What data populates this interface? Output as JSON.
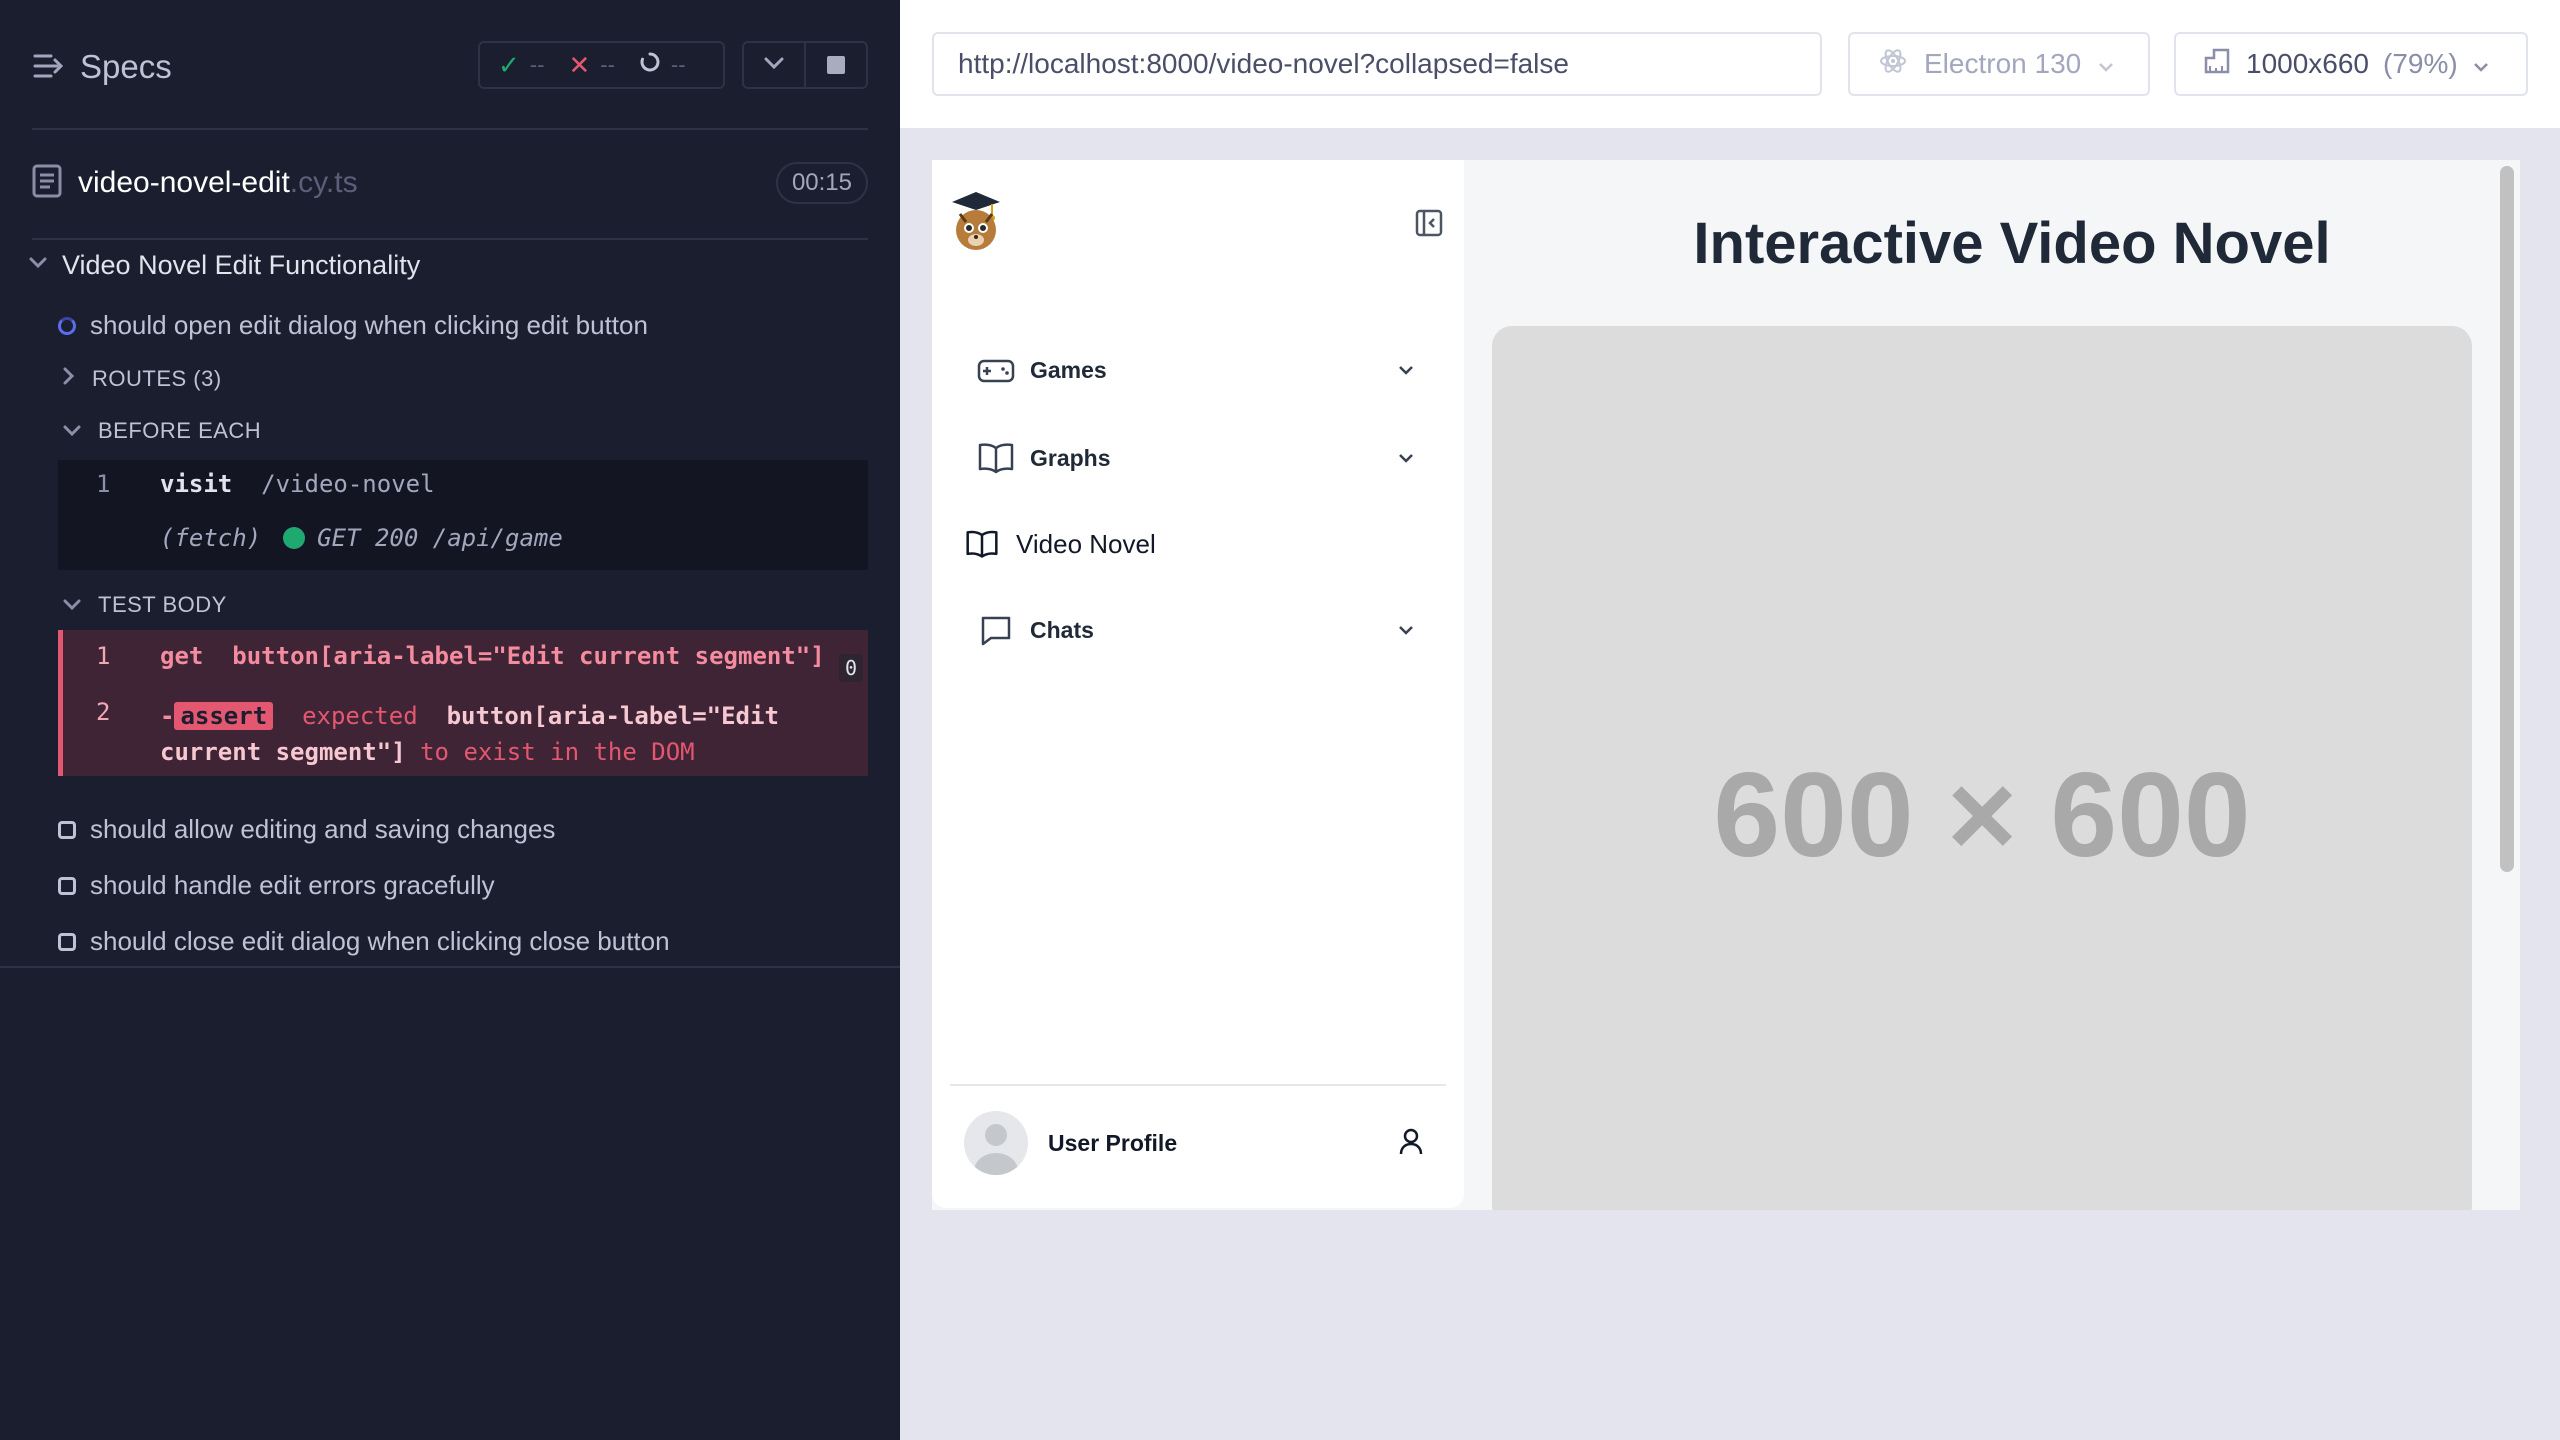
{
  "reporter": {
    "title": "Specs",
    "stats": {
      "passed": "--",
      "failed": "--",
      "pending": "--"
    },
    "file": {
      "name": "video-novel-edit",
      "ext": ".cy.ts",
      "duration": "00:15"
    },
    "suite": "Video Novel Edit Functionality",
    "current_test": "should open edit dialog when clicking edit button",
    "routes_label": "ROUTES (3)",
    "before_each_label": "BEFORE EACH",
    "before_each": {
      "num": "1",
      "command": "visit",
      "message": "/video-novel",
      "fetch": "(fetch)",
      "fetch_message": "GET 200 /api/game"
    },
    "test_body_label": "TEST BODY",
    "test_body": [
      {
        "num": "1",
        "command": "get",
        "message": "button[aria-label=\"Edit current segment\"]",
        "count": "0"
      },
      {
        "num": "2",
        "prefix": "-",
        "command": "assert",
        "expected": "expected",
        "selector_a": "button[aria-label=\"Edit",
        "selector_b": "current segment\"]",
        "tail": "to exist in the DOM"
      }
    ],
    "other_tests": [
      "should allow editing and saving changes",
      "should handle edit errors gracefully",
      "should close edit dialog when clicking close button"
    ]
  },
  "aut": {
    "url": "http://localhost:8000/video-novel?collapsed=false",
    "browser": "Electron 130",
    "viewport": "1000x660",
    "zoom": "(79%)"
  },
  "app": {
    "nav": [
      {
        "label": "Games",
        "icon": "gamepad-icon"
      },
      {
        "label": "Graphs",
        "icon": "book-open-icon"
      },
      {
        "label": "Video Novel",
        "icon": "book-open-icon"
      },
      {
        "label": "Chats",
        "icon": "chat-icon"
      }
    ],
    "profile": "User Profile",
    "title": "Interactive Video Novel",
    "placeholder": "600 × 600"
  },
  "colors": {
    "reporter_bg": "#1b1e2e",
    "pass": "#1fa971",
    "fail": "#e45770",
    "running": "#5a6ef0"
  }
}
